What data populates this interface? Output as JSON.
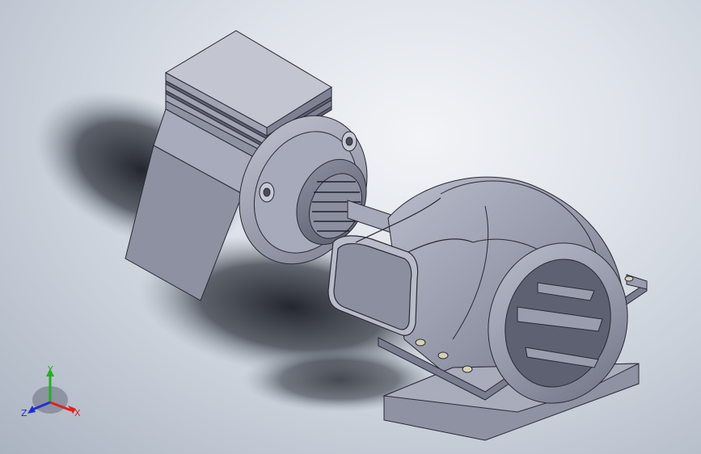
{
  "viewport": {
    "background_top": "#eef1f5",
    "background_bottom": "#aab3c0",
    "model_color": "#9a9dae",
    "edge_color": "#2a2a33"
  },
  "triad": {
    "x_label": "X",
    "y_label": "Y",
    "z_label": "Z",
    "x_color": "#e02020",
    "y_color": "#20b020",
    "z_color": "#2030d0"
  },
  "model": {
    "parts": [
      "motor-housing",
      "motor-flange",
      "coupling",
      "shaft",
      "turbine-inlet",
      "spiral-casing",
      "runner-ring",
      "base-plate"
    ],
    "bolt_count": 3
  }
}
